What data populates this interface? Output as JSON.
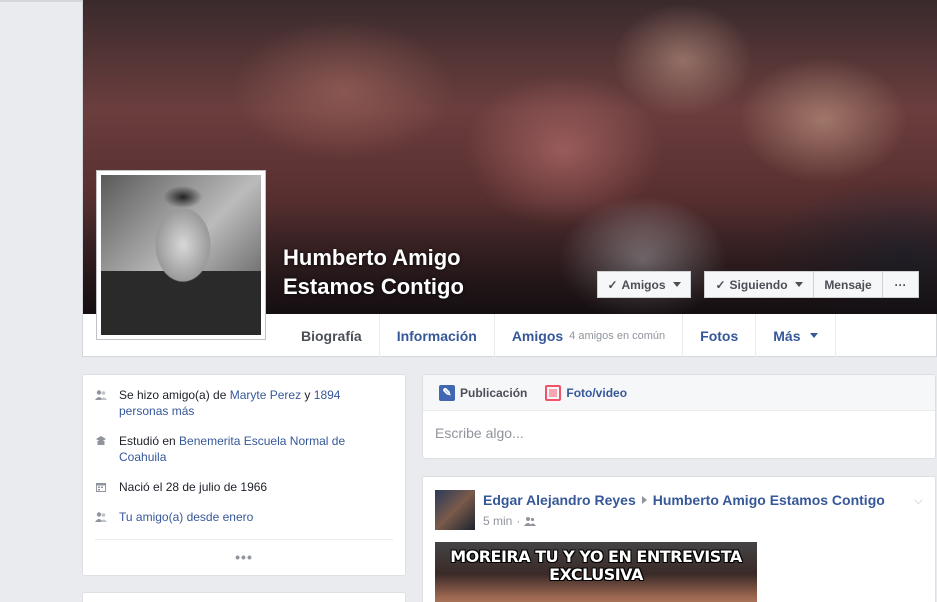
{
  "profile": {
    "name_line1": "Humberto Amigo",
    "name_line2": "Estamos Contigo"
  },
  "actions": {
    "friends_label": "Amigos",
    "following_label": "Siguiendo",
    "message_label": "Mensaje",
    "more_label": "···"
  },
  "tabs": [
    {
      "label": "Biografía"
    },
    {
      "label": "Información"
    },
    {
      "label": "Amigos",
      "sub": "4 amigos en común"
    },
    {
      "label": "Fotos"
    },
    {
      "label": "Más"
    }
  ],
  "intro": {
    "friend_text_pre": "Se hizo amigo(a) de ",
    "friend_link1": "Maryte Perez",
    "friend_text_mid": " y ",
    "friend_link2": "1894 personas más",
    "studied_pre": "Estudió en ",
    "studied_link": "Benemerita Escuela Normal de Coahuila",
    "born": "Nació el 28 de julio de 1966",
    "friend_since": "Tu amigo(a) desde enero",
    "more_dots": "•••"
  },
  "composer": {
    "post_tab": "Publicación",
    "photo_tab": "Foto/video",
    "placeholder": "Escribe algo..."
  },
  "post": {
    "author": "Edgar Alejandro Reyes",
    "target": "Humberto Amigo Estamos Contigo",
    "time": "5 min",
    "image_text_line1": "MOREIRA TU Y YO EN ENTREVISTA",
    "image_text_line2": "EXCLUSIVA"
  }
}
